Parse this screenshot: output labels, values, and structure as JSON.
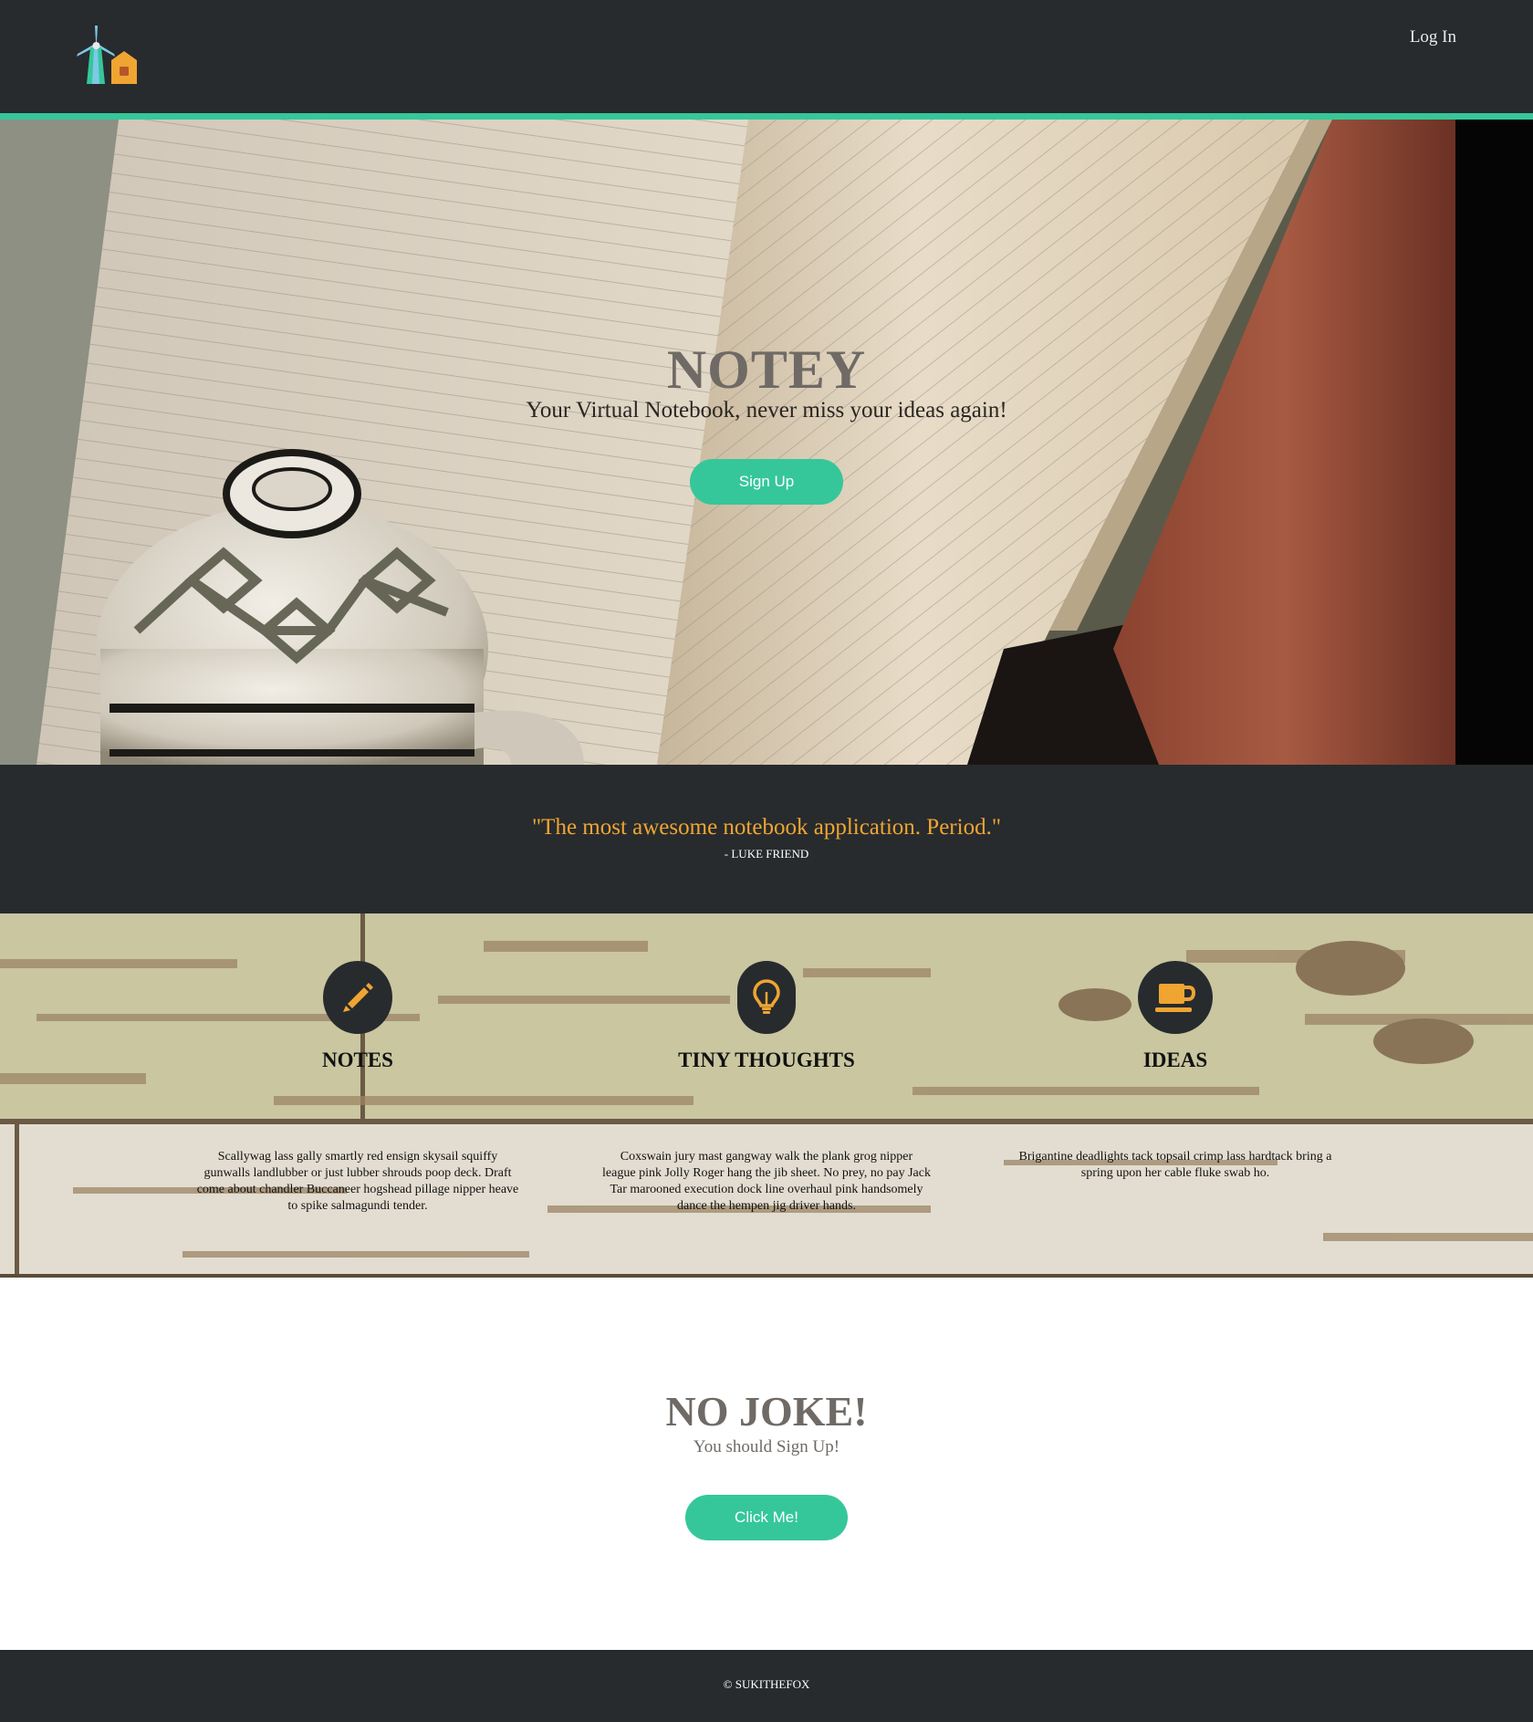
{
  "navbar": {
    "logo": "windmill-house-logo",
    "login_label": "Log In"
  },
  "hero": {
    "title": "NOTEY",
    "subtitle": "Your Virtual Notebook, never miss your ideas again!",
    "button_label": "Sign Up"
  },
  "quote": {
    "text": "\"The most awesome notebook application. Period.\"",
    "author": "- LUKE FRIEND"
  },
  "features": [
    {
      "icon": "pencil-icon",
      "title": "NOTES",
      "text": "Scallywag lass gally smartly red ensign skysail squiffy gunwalls landlubber or just lubber shrouds poop deck. Draft come about chandler Buccaneer hogshead pillage nipper heave to spike salmagundi tender."
    },
    {
      "icon": "lightbulb-icon",
      "title": "TINY THOUGHTS",
      "text": "Coxswain jury mast gangway walk the plank grog nipper league pink Jolly Roger hang the jib sheet. No prey, no pay Jack Tar marooned execution dock line overhaul pink handsomely dance the hempen jig driver hands."
    },
    {
      "icon": "coffee-icon",
      "title": "IDEAS",
      "text": "Brigantine deadlights tack topsail crimp lass hardtack bring a spring upon her cable fluke swab ho."
    }
  ],
  "cta": {
    "title": "NO JOKE!",
    "subtitle": "You should Sign Up!",
    "button_label": "Click Me!"
  },
  "footer": {
    "text": "© SUKITHEFOX"
  },
  "colors": {
    "dark": "#272b2e",
    "accent": "#35c79a",
    "quote": "#f0a532",
    "icon": "#f0a532"
  }
}
